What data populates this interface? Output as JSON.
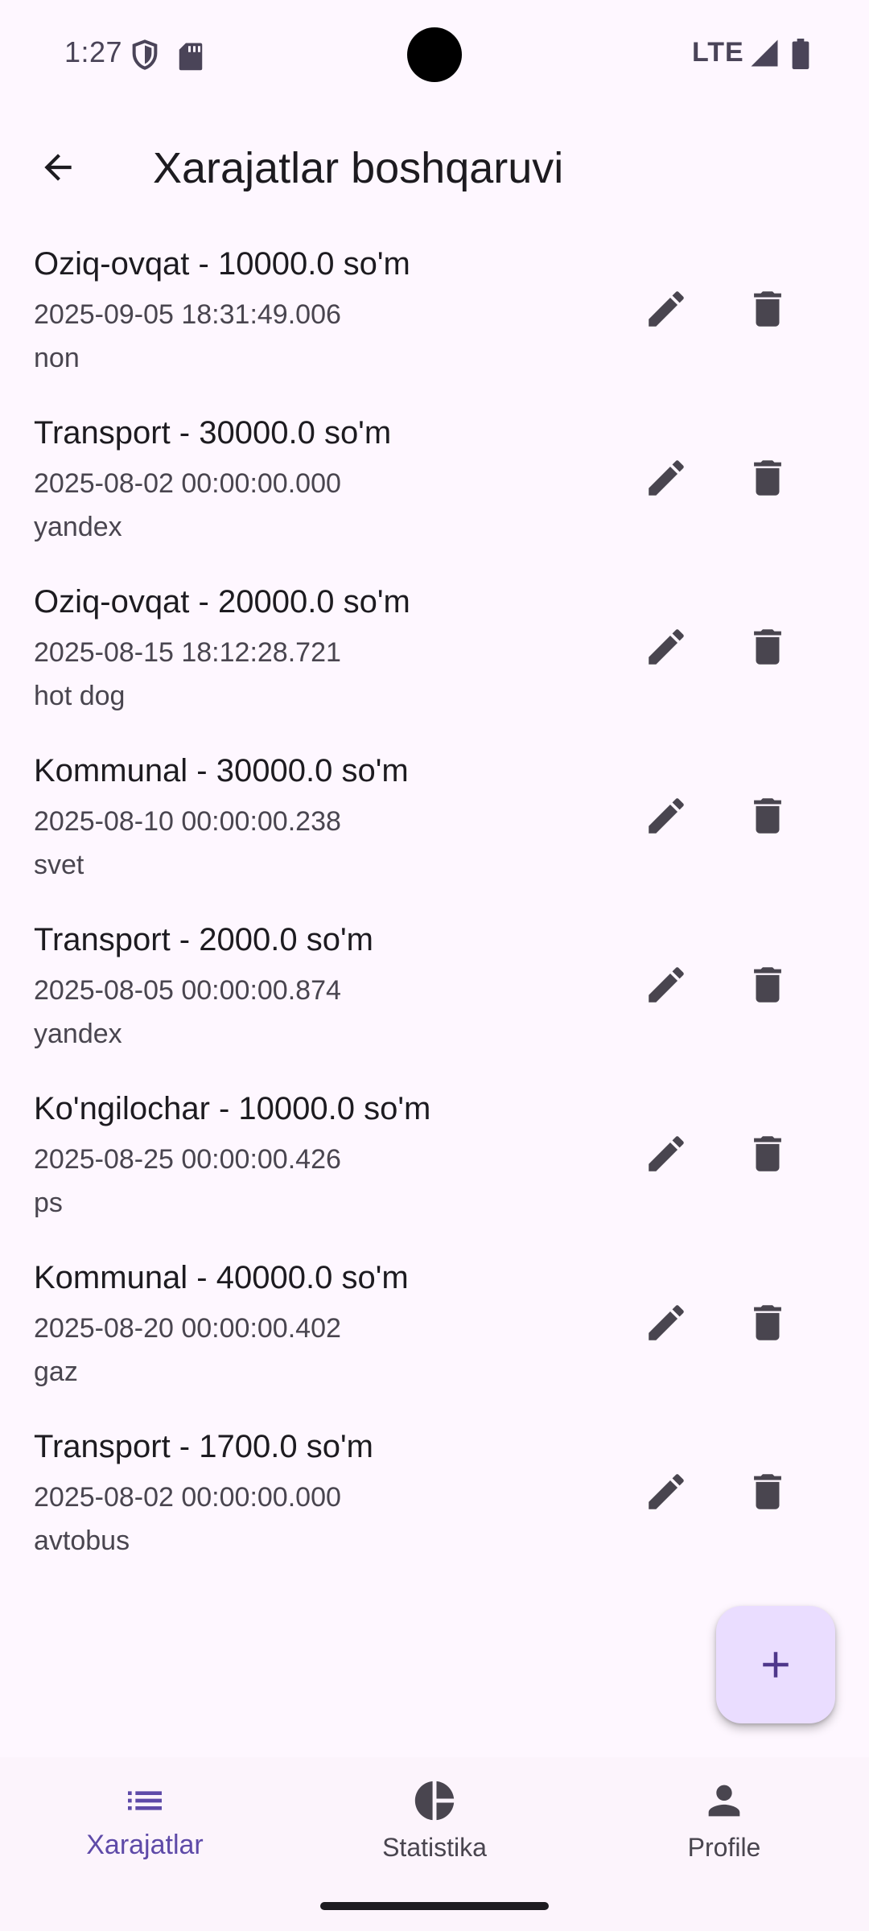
{
  "status_bar": {
    "time": "1:27",
    "network": "LTE"
  },
  "app_bar": {
    "title": "Xarajatlar boshqaruvi"
  },
  "expenses": [
    {
      "title": "Oziq-ovqat - 10000.0 so'm",
      "date": "2025-09-05 18:31:49.006",
      "note": "non"
    },
    {
      "title": "Transport - 30000.0 so'm",
      "date": "2025-08-02 00:00:00.000",
      "note": "yandex"
    },
    {
      "title": "Oziq-ovqat - 20000.0 so'm",
      "date": "2025-08-15 18:12:28.721",
      "note": "hot dog"
    },
    {
      "title": "Kommunal - 30000.0 so'm",
      "date": "2025-08-10 00:00:00.238",
      "note": "svet"
    },
    {
      "title": "Transport - 2000.0 so'm",
      "date": "2025-08-05 00:00:00.874",
      "note": "yandex"
    },
    {
      "title": "Ko'ngilochar - 10000.0 so'm",
      "date": "2025-08-25 00:00:00.426",
      "note": "ps"
    },
    {
      "title": "Kommunal - 40000.0 so'm",
      "date": "2025-08-20 00:00:00.402",
      "note": "gaz"
    },
    {
      "title": "Transport - 1700.0 so'm",
      "date": "2025-08-02 00:00:00.000",
      "note": "avtobus"
    }
  ],
  "bottom_nav": {
    "items": [
      {
        "label": "Xarajatlar",
        "icon": "list-icon",
        "active": true
      },
      {
        "label": "Statistika",
        "icon": "pie-chart-icon",
        "active": false
      },
      {
        "label": "Profile",
        "icon": "person-icon",
        "active": false
      }
    ]
  },
  "colors": {
    "background": "#FEF7FF",
    "accent": "#5E4AA8",
    "fab_background": "#EADDFF",
    "icon": "#49454F"
  }
}
